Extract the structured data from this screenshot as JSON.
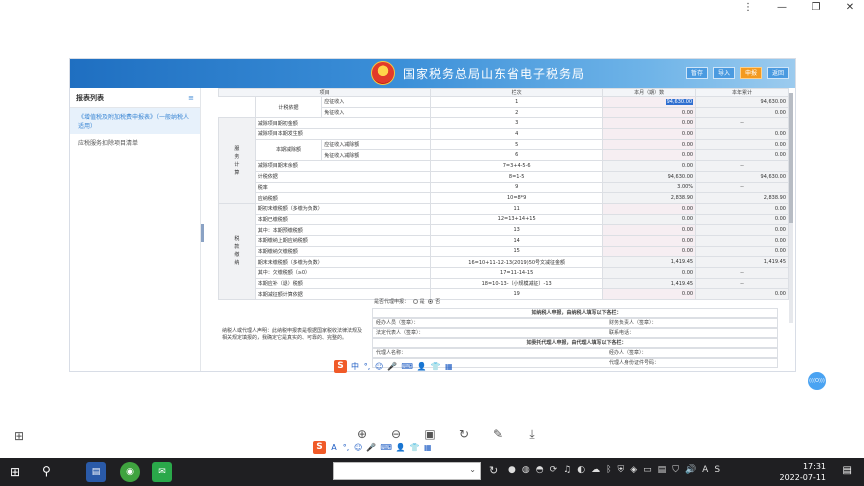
{
  "app": {
    "title": "国家税务总局山东省电子税务局",
    "header_buttons": [
      "暂存",
      "导入",
      "申报",
      "返回"
    ]
  },
  "sidebar": {
    "heading": "报表列表",
    "items": [
      "《增值税及附加税费申报表》（一般纳税人适用）",
      "应税服务扣除项目清单"
    ]
  },
  "table": {
    "headers": [
      "项目",
      "栏次",
      "本月（期）数",
      "本年累计"
    ],
    "rows": [
      {
        "group": "",
        "label": "计税依据",
        "sub": "应征收入",
        "line": "1",
        "month": "94,630.00",
        "year": "94,630.00"
      },
      {
        "group": "",
        "label": "",
        "sub": "免征收入",
        "line": "2",
        "month": "0.00",
        "year": "0.00"
      },
      {
        "group": "",
        "label": "减除项目期初金额",
        "sub": "",
        "line": "3",
        "month": "0.00",
        "year": "--"
      },
      {
        "group": "",
        "label": "减除项目本期发生额",
        "sub": "",
        "line": "4",
        "month": "0.00",
        "year": "0.00"
      },
      {
        "group": "",
        "label": "本期减除额",
        "sub": "应征收入减除额",
        "line": "5",
        "month": "0.00",
        "year": "0.00"
      },
      {
        "group": "",
        "label": "",
        "sub": "免征收入减除额",
        "line": "6",
        "month": "0.00",
        "year": "0.00"
      },
      {
        "group": "",
        "label": "减除项目期末余额",
        "sub": "",
        "line": "7=3+4-5-6",
        "month": "0.00",
        "year": "--"
      },
      {
        "group": "",
        "label": "计税依据",
        "sub": "",
        "line": "8=1-5",
        "month": "94,630.00",
        "year": "94,630.00"
      },
      {
        "group": "",
        "label": "税率",
        "sub": "",
        "line": "9",
        "month": "3.00%",
        "year": "--"
      },
      {
        "group": "",
        "label": "应纳税额",
        "sub": "",
        "line": "10=8*9",
        "month": "2,838.90",
        "year": "2,838.90"
      },
      {
        "group": "",
        "label": "期初未缴税额（多缴为负数）",
        "sub": "",
        "line": "11",
        "month": "0.00",
        "year": "0.00"
      },
      {
        "group": "",
        "label": "本期已缴税额",
        "sub": "",
        "line": "12=13+14+15",
        "month": "0.00",
        "year": "0.00"
      },
      {
        "group": "",
        "label": "其中：本期预缴税额",
        "sub": "",
        "line": "13",
        "month": "0.00",
        "year": "0.00"
      },
      {
        "group": "",
        "label": "本期缴纳上期应纳税额",
        "sub": "",
        "line": "14",
        "month": "0.00",
        "year": "0.00"
      },
      {
        "group": "",
        "label": "本期缴纳欠缴税额",
        "sub": "",
        "line": "15",
        "month": "0.00",
        "year": "0.00"
      },
      {
        "group": "",
        "label": "期末未缴税额（多缴为负数）",
        "sub": "",
        "line": "16=10+11-12-13(2019)50号文减征金额",
        "month": "1,419.45",
        "year": "1,419.45"
      },
      {
        "group": "",
        "label": "其中：欠缴税额（≥0）",
        "sub": "",
        "line": "17=11-14-15",
        "month": "0.00",
        "year": "--"
      },
      {
        "group": "",
        "label": "本期应补（退）税额",
        "sub": "",
        "line": "18=10-13-（小规模减征）-13",
        "month": "1,419.45",
        "year": "--"
      },
      {
        "group": "",
        "label": "本期减征额计算依据",
        "sub": "",
        "line": "19",
        "month": "0.00",
        "year": "0.00"
      }
    ],
    "group_labels": [
      [
        "服",
        "务",
        "计",
        "算"
      ],
      [
        "税",
        "款",
        "缴",
        "纳"
      ]
    ]
  },
  "lower": {
    "question": "是否代理申报：",
    "opt_yes": "是",
    "opt_no": "否",
    "declaration": "纳税人或代理人声明：此纳税申报表是根据国家税收法律法规及相关规定填报的，我确定它是真实的、可靠的、完整的。",
    "self_title": "如纳税人申报，由纳税人填写以下各栏：",
    "agent_title": "如委托代理人申报，由代理人填写以下各栏：",
    "f1": "经办人员（签章）：",
    "f2": "财务负责人（签章）：",
    "f3": "法定代表人（签章）：",
    "f4": "联系电话：",
    "f5": "代理人名称：",
    "f6": "经办人（签章）：",
    "f7": "代理人身份证件号码："
  },
  "ime": {
    "logo": "S",
    "mode": "中",
    "items": [
      "°,",
      "☺",
      "🎤",
      "⌨",
      "👤",
      "👕",
      "▦"
    ]
  },
  "bubble_label": "(((O)))",
  "taskbar": {
    "time": "17:31",
    "date": "2022-07-11"
  }
}
